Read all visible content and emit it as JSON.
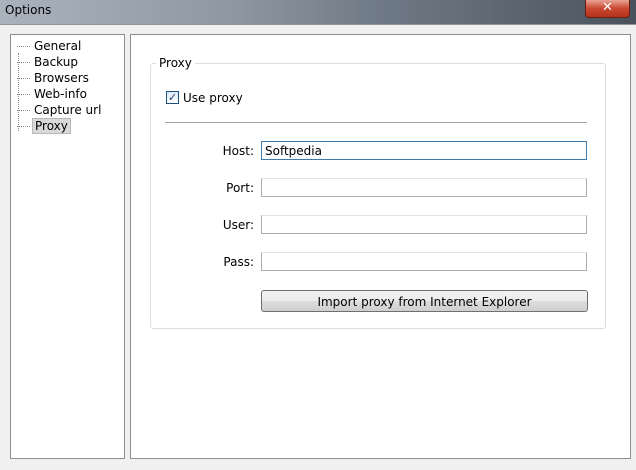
{
  "window": {
    "title": "Options",
    "close_glyph": "✕"
  },
  "tree": {
    "items": [
      {
        "label": "General"
      },
      {
        "label": "Backup"
      },
      {
        "label": "Browsers"
      },
      {
        "label": "Web-info"
      },
      {
        "label": "Capture url"
      },
      {
        "label": "Proxy"
      }
    ],
    "selected": "Proxy"
  },
  "proxy": {
    "group_caption": "Proxy",
    "use_proxy_label": "Use proxy",
    "use_proxy_checked": true,
    "check_glyph": "✓",
    "host_label": "Host:",
    "host_value": "Softpedia",
    "port_label": "Port:",
    "port_value": "",
    "user_label": "User:",
    "user_value": "",
    "pass_label": "Pass:",
    "pass_value": "",
    "import_button_label": "Import proxy from Internet Explorer"
  }
}
